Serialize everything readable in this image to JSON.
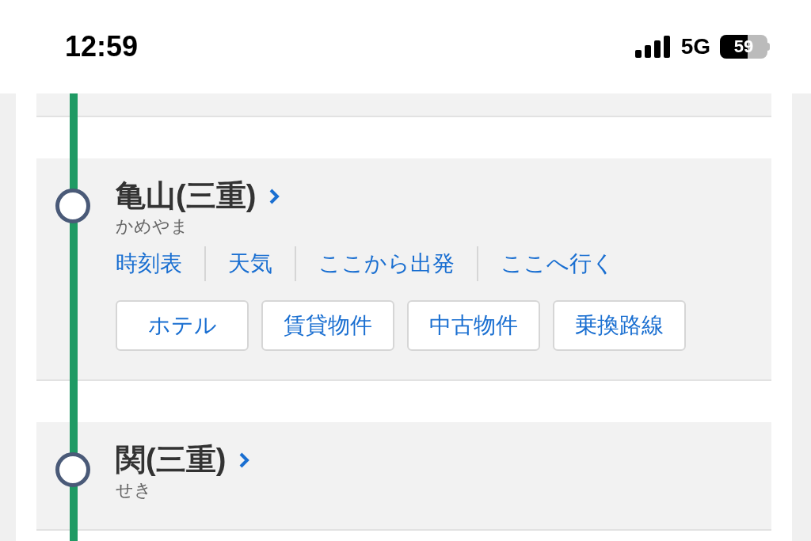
{
  "status_bar": {
    "time": "12:59",
    "network": "5G",
    "battery": "59"
  },
  "stations": [
    {
      "name": "亀山(三重)",
      "reading": "かめやま",
      "links": [
        "時刻表",
        "天気",
        "ここから出発",
        "ここへ行く"
      ],
      "buttons": [
        "ホテル",
        "賃貸物件",
        "中古物件",
        "乗換路線"
      ]
    },
    {
      "name": "関(三重)",
      "reading": "せき"
    }
  ]
}
